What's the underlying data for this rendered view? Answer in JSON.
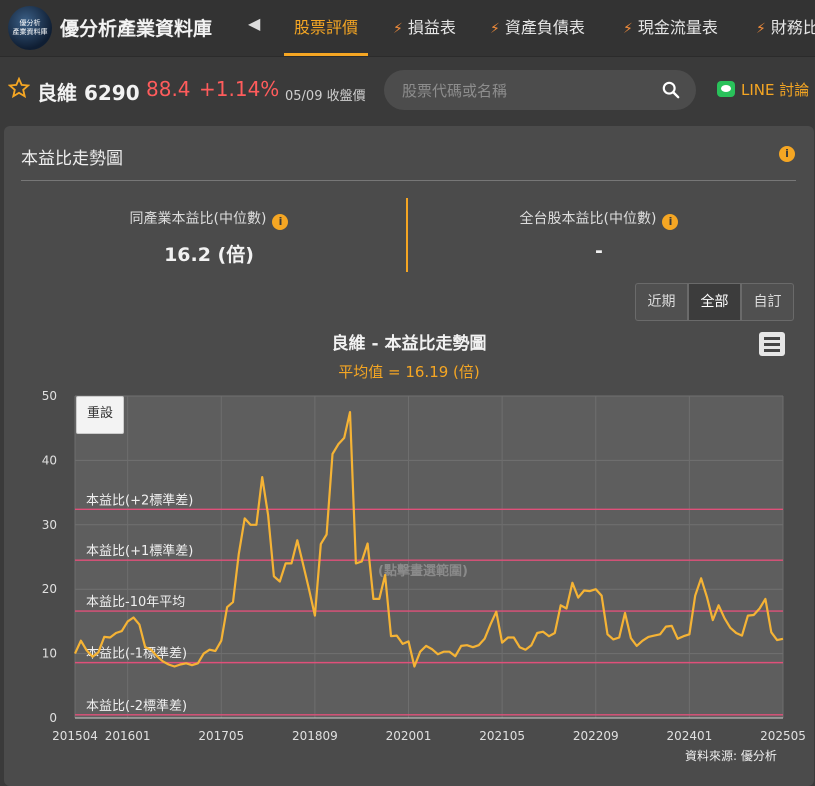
{
  "brand": {
    "name": "優分析產業資料庫",
    "logo_text_1": "優分析",
    "logo_text_2": "產業資料庫"
  },
  "nav": {
    "tabs": [
      {
        "label": "股票評價",
        "active": true
      },
      {
        "label": "損益表"
      },
      {
        "label": "資產負債表"
      },
      {
        "label": "現金流量表"
      },
      {
        "label": "財務比"
      }
    ]
  },
  "stock": {
    "name_code": "良維 6290",
    "price": "88.4",
    "change": "+1.14%",
    "close_label": "05/09 收盤價",
    "color_up": "#ff5c5c"
  },
  "search": {
    "placeholder": "股票代碼或名稱"
  },
  "line_link": {
    "label": "LINE 討論"
  },
  "card": {
    "title": "本益比走勢圖",
    "industry": {
      "label": "同產業本益比(中位數)",
      "value": "16.2 (倍)"
    },
    "market": {
      "label": "全台股本益比(中位數)",
      "value": "-"
    },
    "range_buttons": [
      {
        "label": "近期"
      },
      {
        "label": "全部",
        "active": true
      },
      {
        "label": "自訂"
      }
    ],
    "reset_label": "重設",
    "source": "資料來源: 優分析",
    "info_glyph": "i"
  },
  "chart_data": {
    "type": "line",
    "title": "良維 - 本益比走勢圖",
    "subtitle": "平均值 = 16.19 (倍)",
    "watermark": "(點擊畫選範圍)",
    "ylim": [
      0,
      50
    ],
    "y_ticks": [
      "0",
      "10",
      "20",
      "30",
      "40",
      "50"
    ],
    "x_ticks": [
      "201504",
      "201601",
      "201705",
      "201809",
      "202001",
      "202105",
      "202209",
      "202401",
      "202505"
    ],
    "line_color": "#f5b335",
    "band_color": "#e0507a",
    "bands": [
      {
        "label": "本益比(+2標準差)",
        "value": 32.4
      },
      {
        "label": "本益比(+1標準差)",
        "value": 24.5
      },
      {
        "label": "本益比-10年平均",
        "value": 16.6
      },
      {
        "label": "本益比(-1標準差)",
        "value": 8.6
      },
      {
        "label": "本益比(-2標準差)",
        "value": 0.5
      }
    ],
    "x_start": "2015-04",
    "series": [
      {
        "values": [
          10,
          12,
          10.5,
          9.5,
          10.2,
          12.6,
          12.5,
          13.2,
          13.5,
          15,
          15.6,
          14.5,
          11,
          10.6,
          9.6,
          8.8,
          8.3,
          8,
          8.3,
          8.5,
          8.2,
          8.5,
          10,
          10.6,
          10.4,
          12,
          17.2,
          18,
          25.5,
          31,
          30,
          30,
          37.4,
          31.5,
          22,
          21.2,
          24,
          24,
          27.6,
          23.8,
          20,
          15.9,
          27,
          28.5,
          41,
          42.5,
          43.5,
          47.5,
          24,
          24.3,
          27.1,
          18.5,
          18.5,
          22.2,
          12.7,
          12.8,
          11.5,
          11.9,
          8,
          10.3,
          11.2,
          10.7,
          9.9,
          10.3,
          10.3,
          9.6,
          11.2,
          11.3,
          11,
          11.3,
          12.3,
          14.5,
          16.5,
          11.7,
          12.5,
          12.5,
          11,
          10.6,
          11.3,
          13.2,
          13.4,
          12.7,
          13.2,
          17.5,
          17,
          21,
          18.7,
          19.8,
          19.7,
          20,
          19,
          13,
          12.2,
          12.5,
          16.3,
          12.4,
          11.2,
          12,
          12.6,
          12.8,
          13,
          14.2,
          14.3,
          12.3,
          12.7,
          13,
          19,
          21.7,
          18.8,
          15.2,
          17.5,
          15.5,
          14,
          13.2,
          12.8,
          15.9,
          16,
          17,
          18.5,
          13.3,
          12.1,
          12.3
        ]
      }
    ]
  }
}
